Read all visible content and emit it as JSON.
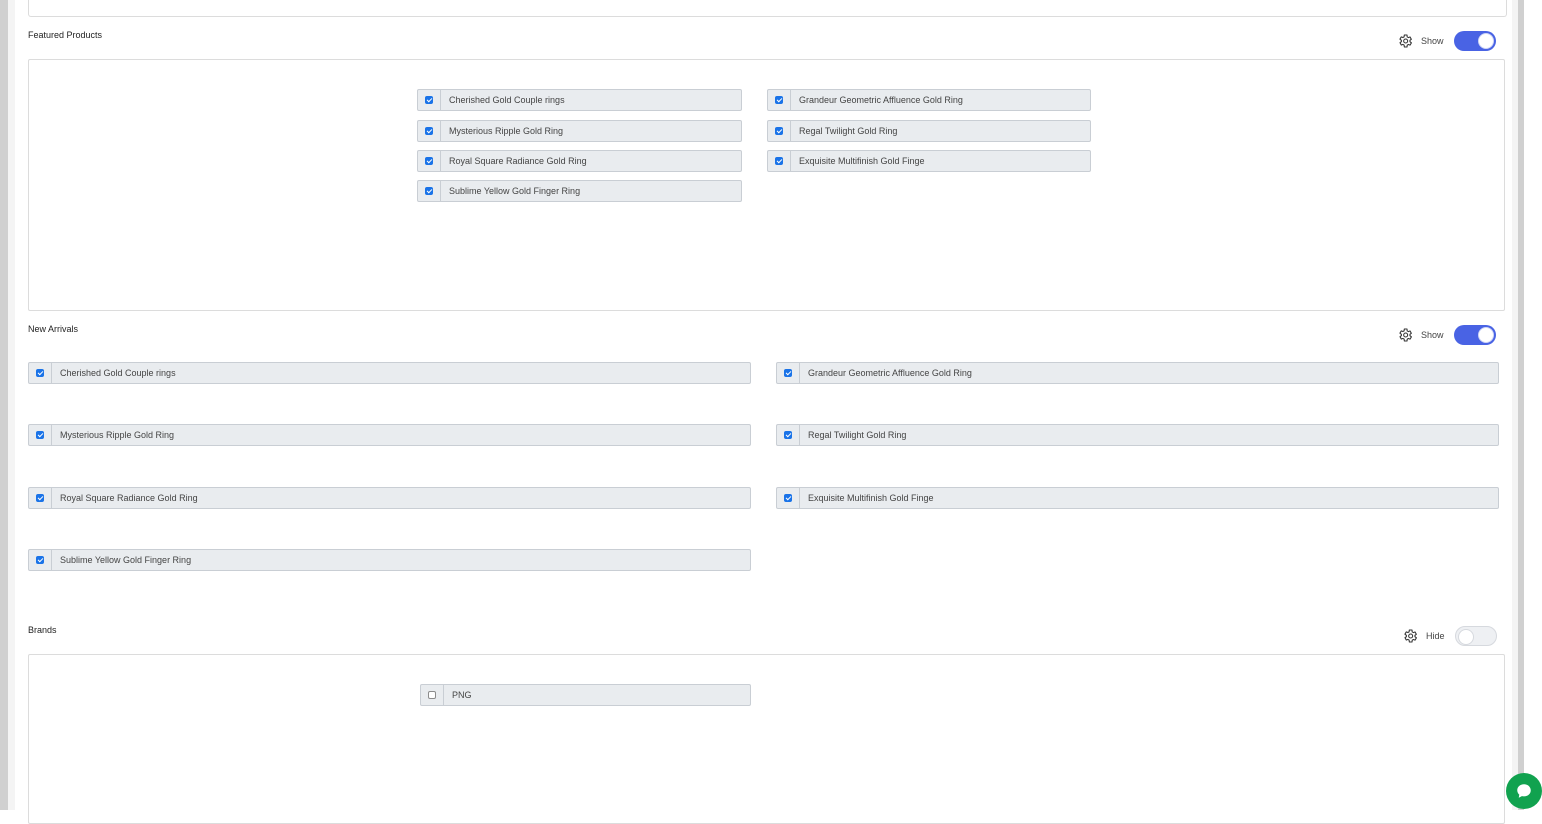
{
  "sections": [
    {
      "title": "Featured Products",
      "status_label": "Show",
      "enabled": true,
      "items": [
        {
          "label": "Cherished Gold Couple rings",
          "checked": true
        },
        {
          "label": "Grandeur Geometric Affluence Gold Ring",
          "checked": true
        },
        {
          "label": "Mysterious Ripple Gold Ring",
          "checked": true
        },
        {
          "label": "Regal Twilight Gold Ring",
          "checked": true
        },
        {
          "label": "Royal Square Radiance Gold Ring",
          "checked": true
        },
        {
          "label": "Exquisite Multifinish Gold Finge",
          "checked": true
        },
        {
          "label": "Sublime Yellow Gold Finger Ring",
          "checked": true
        }
      ]
    },
    {
      "title": "New Arrivals",
      "status_label": "Show",
      "enabled": true,
      "items": [
        {
          "label": "Cherished Gold Couple rings",
          "checked": true
        },
        {
          "label": "Grandeur Geometric Affluence Gold Ring",
          "checked": true
        },
        {
          "label": "Mysterious Ripple Gold Ring",
          "checked": true
        },
        {
          "label": "Regal Twilight Gold Ring",
          "checked": true
        },
        {
          "label": "Royal Square Radiance Gold Ring",
          "checked": true
        },
        {
          "label": "Exquisite Multifinish Gold Finge",
          "checked": true
        },
        {
          "label": "Sublime Yellow Gold Finger Ring",
          "checked": true
        }
      ]
    },
    {
      "title": "Brands",
      "status_label": "Hide",
      "enabled": false,
      "items": [
        {
          "label": "PNG",
          "checked": false
        }
      ]
    }
  ],
  "icons": {
    "settings": "gear-icon",
    "chat": "chat-bubble-icon"
  },
  "colors": {
    "toggle_on": "#4963e4",
    "checkbox": "#1a73e8",
    "chat_button": "#11a24f",
    "item_background": "#e9ecef"
  }
}
